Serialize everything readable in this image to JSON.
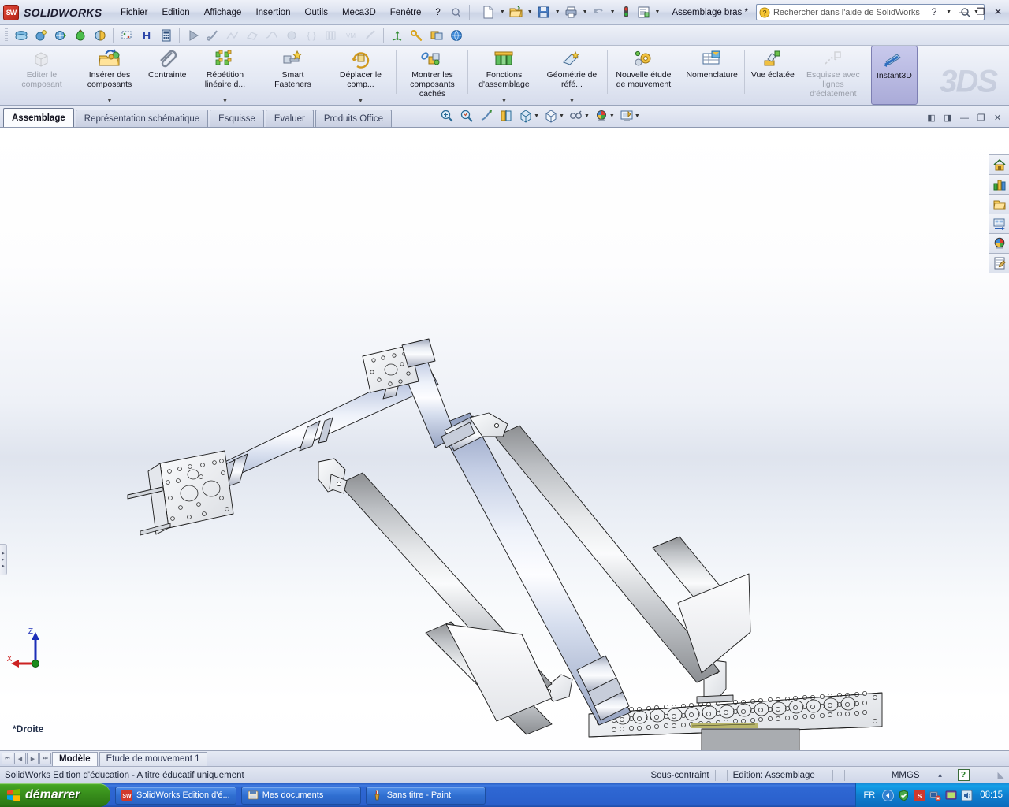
{
  "titlebar": {
    "brand": "SOLIDWORKS",
    "brand_mark": "SW",
    "menu": [
      {
        "label": "Fichier"
      },
      {
        "label": "Edition"
      },
      {
        "label": "Affichage"
      },
      {
        "label": "Insertion"
      },
      {
        "label": "Outils"
      },
      {
        "label": "Meca3D"
      },
      {
        "label": "Fenêtre"
      },
      {
        "label": "?"
      }
    ],
    "quick_icons": [
      {
        "name": "new-document-icon"
      },
      {
        "name": "open-folder-icon"
      },
      {
        "name": "save-icon"
      },
      {
        "name": "print-icon"
      },
      {
        "name": "undo-icon"
      },
      {
        "name": "rebuild-status-icon"
      },
      {
        "name": "options-icon"
      }
    ],
    "document_title": "Assemblage bras *",
    "search": {
      "placeholder": "Rechercher dans l'aide de SolidWorks",
      "value": "",
      "icon": "help-question-icon",
      "magnifier": "search-icon"
    },
    "help_label": "?",
    "window_buttons": [
      {
        "name": "minimize-button",
        "glyph": "—"
      },
      {
        "name": "restore-button",
        "glyph": "❐"
      },
      {
        "name": "close-button",
        "glyph": "✕"
      }
    ]
  },
  "toolbar2": {
    "groups": [
      [
        "shaded-view-icon",
        "apply-scene-icon",
        "view-orientation-icon",
        "appearance-icon",
        "section-view-icon"
      ],
      [
        "display-style-icon",
        "hide-show-icon",
        "measure-icon"
      ],
      [
        "play-animation-icon",
        "edit-sketch-icon",
        "line-icon",
        "polygon-icon",
        "spline-icon",
        "fillet-icon",
        "trim-icon",
        "mirror-icon",
        "dimension-icon",
        "relation-icon"
      ],
      [
        "coordinate-system-icon",
        "mate-icon",
        "assembly-icon",
        "globe-icon"
      ]
    ]
  },
  "ribbon": {
    "buttons": [
      {
        "label": "Editer le composant",
        "name": "edit-component",
        "icon": "edit-component-icon",
        "disabled": true,
        "caret": false
      },
      {
        "label": "Insérer des composants",
        "name": "insert-components",
        "icon": "insert-component-icon",
        "disabled": false,
        "caret": true
      },
      {
        "label": "Contrainte",
        "name": "mate",
        "icon": "paperclip-mate-icon",
        "disabled": false,
        "caret": false
      },
      {
        "label": "Répétition linéaire d...",
        "name": "linear-pattern",
        "icon": "linear-pattern-icon",
        "disabled": false,
        "caret": true
      },
      {
        "label": "Smart Fasteners",
        "name": "smart-fasteners",
        "icon": "smart-fasteners-icon",
        "disabled": false,
        "caret": false
      },
      {
        "label": "Déplacer le comp...",
        "name": "move-component",
        "icon": "move-component-icon",
        "disabled": false,
        "caret": true
      },
      {
        "label": "Montrer les composants cachés",
        "name": "show-hidden-components",
        "icon": "show-hidden-icon",
        "disabled": false,
        "caret": false
      },
      {
        "label": "Fonctions d'assemblage",
        "name": "assembly-features",
        "icon": "assembly-features-icon",
        "disabled": false,
        "caret": true
      },
      {
        "label": "Géométrie de réfé...",
        "name": "reference-geometry",
        "icon": "reference-geometry-icon",
        "disabled": false,
        "caret": true
      },
      {
        "label": "Nouvelle étude de mouvement",
        "name": "new-motion-study",
        "icon": "motion-study-icon",
        "disabled": false,
        "caret": false
      },
      {
        "label": "Nomenclature",
        "name": "bill-of-materials",
        "icon": "bom-icon",
        "disabled": false,
        "caret": false
      },
      {
        "label": "Vue éclatée",
        "name": "exploded-view",
        "icon": "exploded-view-icon",
        "disabled": false,
        "caret": false
      },
      {
        "label": "Esquisse avec lignes d'éclatement",
        "name": "explode-line-sketch",
        "icon": "explode-line-icon",
        "disabled": true,
        "caret": false
      },
      {
        "label": "Instant3D",
        "name": "instant3d",
        "icon": "instant3d-icon",
        "disabled": false,
        "caret": false,
        "active": true
      }
    ],
    "watermark": "3DS"
  },
  "tabs": [
    {
      "label": "Assemblage",
      "name": "tab-assemblage",
      "selected": true
    },
    {
      "label": "Représentation schématique",
      "name": "tab-representation-schematique",
      "selected": false
    },
    {
      "label": "Esquisse",
      "name": "tab-esquisse",
      "selected": false
    },
    {
      "label": "Evaluer",
      "name": "tab-evaluer",
      "selected": false
    },
    {
      "label": "Produits Office",
      "name": "tab-produits-office",
      "selected": false
    }
  ],
  "view_toolbar": [
    {
      "name": "zoom-to-fit-icon",
      "caret": false
    },
    {
      "name": "zoom-to-area-icon",
      "caret": false
    },
    {
      "name": "previous-view-icon",
      "caret": false
    },
    {
      "name": "section-view-icon",
      "caret": false
    },
    {
      "name": "view-orientation-icon",
      "caret": true
    },
    {
      "name": "display-style-icon",
      "caret": true
    },
    {
      "name": "hide-show-items-icon",
      "caret": true
    },
    {
      "name": "apply-scene-icon",
      "caret": true
    },
    {
      "name": "view-settings-icon",
      "caret": true
    }
  ],
  "window_mini_buttons": [
    {
      "name": "tile-left-button",
      "glyph": "◧"
    },
    {
      "name": "tile-right-button",
      "glyph": "◨"
    },
    {
      "name": "minimize-doc-button",
      "glyph": "—"
    },
    {
      "name": "restore-doc-button",
      "glyph": "❐"
    },
    {
      "name": "close-doc-button",
      "glyph": "✕"
    }
  ],
  "task_pane": [
    {
      "name": "sw-resources-icon"
    },
    {
      "name": "design-library-icon"
    },
    {
      "name": "file-explorer-icon"
    },
    {
      "name": "view-palette-icon"
    },
    {
      "name": "appearances-scenes-icon"
    },
    {
      "name": "custom-properties-icon"
    }
  ],
  "viewport": {
    "view_label": "*Droite",
    "triad": {
      "z": "Z",
      "x": "X"
    },
    "model_name": "Assemblage bras",
    "accent_part": "#b9c4e0",
    "accent_cylinder": "#c9ccd0"
  },
  "model_tabs": {
    "nav": [
      "⏮",
      "◀",
      "▶",
      "⏭"
    ],
    "tabs": [
      {
        "label": "Modèle",
        "name": "model-tab",
        "selected": true
      },
      {
        "label": "Etude de mouvement 1",
        "name": "motion-study-tab",
        "selected": false
      }
    ]
  },
  "statusbar": {
    "license": "SolidWorks Edition d'éducation - A titre éducatif uniquement",
    "constraint_state": "Sous-contraint",
    "edit_mode": "Edition: Assemblage",
    "units": "MMGS",
    "units_caret": "▲",
    "help_badge": "?"
  },
  "taskbar": {
    "start_label": "démarrer",
    "items": [
      {
        "label": "SolidWorks Edition d'é...",
        "name": "taskbar-solidworks",
        "icon": "solidworks-icon"
      },
      {
        "label": "Mes documents",
        "name": "taskbar-mes-documents",
        "icon": "folder-icon"
      },
      {
        "label": "Sans titre - Paint",
        "name": "taskbar-paint",
        "icon": "paint-icon"
      }
    ],
    "tray": {
      "language": "FR",
      "icons": [
        "show-hidden-icons-chevron",
        "security-icon",
        "solidworks-tray-icon",
        "network-error-icon",
        "display-icon",
        "volume-icon"
      ],
      "clock": "08:15"
    }
  }
}
